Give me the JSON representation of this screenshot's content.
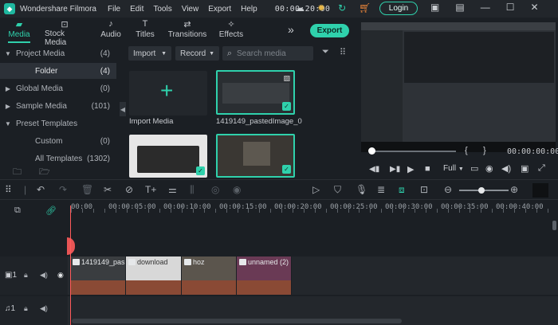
{
  "app": {
    "title": "Wondershare Filmora",
    "timecode": "00:00:20:00"
  },
  "menu": [
    "File",
    "Edit",
    "Tools",
    "View",
    "Export",
    "Help"
  ],
  "header": {
    "login_label": "Login",
    "export_label": "Export"
  },
  "tabs": [
    {
      "label": "Media",
      "icon": "folder-icon",
      "active": true
    },
    {
      "label": "Stock Media",
      "icon": "camera-icon"
    },
    {
      "label": "Audio",
      "icon": "music-note-icon"
    },
    {
      "label": "Titles",
      "icon": "text-t-icon"
    },
    {
      "label": "Transitions",
      "icon": "transition-icon"
    },
    {
      "label": "Effects",
      "icon": "effects-icon"
    }
  ],
  "sidebar": {
    "items": [
      {
        "label": "Project Media",
        "count": "(4)",
        "arrow": "▼"
      },
      {
        "label": "Folder",
        "count": "(4)",
        "arrow": "",
        "selected": true
      },
      {
        "label": "Global Media",
        "count": "(0)",
        "arrow": "▶"
      },
      {
        "label": "Sample Media",
        "count": "(101)",
        "arrow": "▶"
      },
      {
        "label": "Preset Templates",
        "count": "",
        "arrow": "▼"
      },
      {
        "label": "Custom",
        "count": "(0)",
        "arrow": ""
      },
      {
        "label": "All Templates",
        "count": "(1302)",
        "arrow": ""
      }
    ]
  },
  "media_toolbar": {
    "import_label": "Import",
    "record_label": "Record",
    "search_placeholder": "Search media"
  },
  "media": [
    {
      "label": "Import Media"
    },
    {
      "label": "1419149_pastedImage_0"
    }
  ],
  "player": {
    "time": "00:00:00:00",
    "brace_open": "{",
    "brace_close": "}",
    "quality": "Full"
  },
  "ruler": {
    "labels": [
      "00:00",
      "00:00:05:00",
      "00:00:10:00",
      "00:00:15:00",
      "00:00:20:00",
      "00:00:25:00",
      "00:00:30:00",
      "00:00:35:00",
      "00:00:40:00"
    ]
  },
  "clips": [
    {
      "name": "1419149_pas"
    },
    {
      "name": "download"
    },
    {
      "name": "hoz"
    },
    {
      "name": "unnamed (2)"
    }
  ],
  "colors": {
    "accent": "#2fd1ac",
    "playhead": "#ff5b5b",
    "clip_audio": "#8a4a35"
  }
}
